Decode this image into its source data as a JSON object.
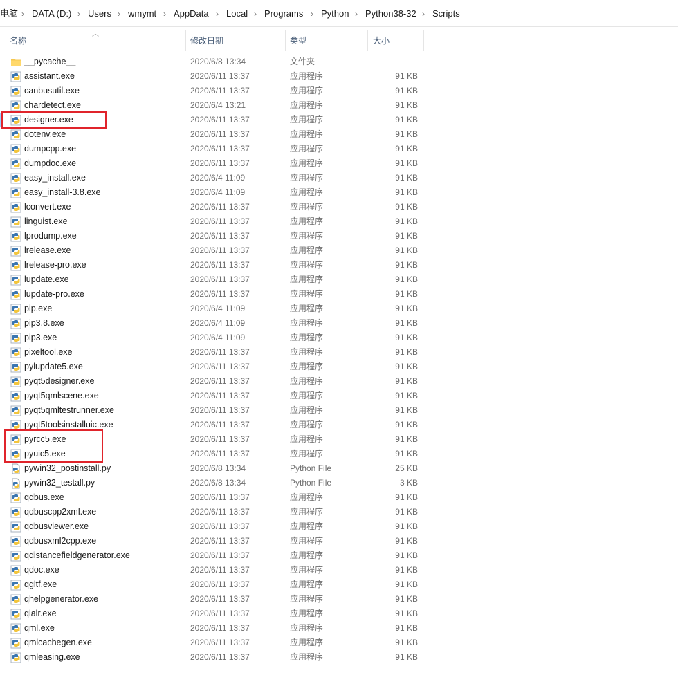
{
  "breadcrumb": [
    "电脑",
    "DATA (D:)",
    "Users",
    "wmymt",
    "AppData",
    "Local",
    "Programs",
    "Python",
    "Python38-32",
    "Scripts"
  ],
  "columns": {
    "name": "名称",
    "date": "修改日期",
    "type": "类型",
    "size": "大小"
  },
  "files": [
    {
      "name": "__pycache__",
      "date": "2020/6/8 13:34",
      "type": "文件夹",
      "size": "",
      "icon": "folder-icon"
    },
    {
      "name": "assistant.exe",
      "date": "2020/6/11 13:37",
      "type": "应用程序",
      "size": "91 KB",
      "icon": "python-exe-icon"
    },
    {
      "name": "canbusutil.exe",
      "date": "2020/6/11 13:37",
      "type": "应用程序",
      "size": "91 KB",
      "icon": "python-exe-icon"
    },
    {
      "name": "chardetect.exe",
      "date": "2020/6/4 13:21",
      "type": "应用程序",
      "size": "91 KB",
      "icon": "python-exe-icon"
    },
    {
      "name": "designer.exe",
      "date": "2020/6/11 13:37",
      "type": "应用程序",
      "size": "91 KB",
      "icon": "python-exe-icon"
    },
    {
      "name": "dotenv.exe",
      "date": "2020/6/11 13:37",
      "type": "应用程序",
      "size": "91 KB",
      "icon": "python-exe-icon"
    },
    {
      "name": "dumpcpp.exe",
      "date": "2020/6/11 13:37",
      "type": "应用程序",
      "size": "91 KB",
      "icon": "python-exe-icon"
    },
    {
      "name": "dumpdoc.exe",
      "date": "2020/6/11 13:37",
      "type": "应用程序",
      "size": "91 KB",
      "icon": "python-exe-icon"
    },
    {
      "name": "easy_install.exe",
      "date": "2020/6/4 11:09",
      "type": "应用程序",
      "size": "91 KB",
      "icon": "python-exe-icon"
    },
    {
      "name": "easy_install-3.8.exe",
      "date": "2020/6/4 11:09",
      "type": "应用程序",
      "size": "91 KB",
      "icon": "python-exe-icon"
    },
    {
      "name": "lconvert.exe",
      "date": "2020/6/11 13:37",
      "type": "应用程序",
      "size": "91 KB",
      "icon": "python-exe-icon"
    },
    {
      "name": "linguist.exe",
      "date": "2020/6/11 13:37",
      "type": "应用程序",
      "size": "91 KB",
      "icon": "python-exe-icon"
    },
    {
      "name": "lprodump.exe",
      "date": "2020/6/11 13:37",
      "type": "应用程序",
      "size": "91 KB",
      "icon": "python-exe-icon"
    },
    {
      "name": "lrelease.exe",
      "date": "2020/6/11 13:37",
      "type": "应用程序",
      "size": "91 KB",
      "icon": "python-exe-icon"
    },
    {
      "name": "lrelease-pro.exe",
      "date": "2020/6/11 13:37",
      "type": "应用程序",
      "size": "91 KB",
      "icon": "python-exe-icon"
    },
    {
      "name": "lupdate.exe",
      "date": "2020/6/11 13:37",
      "type": "应用程序",
      "size": "91 KB",
      "icon": "python-exe-icon"
    },
    {
      "name": "lupdate-pro.exe",
      "date": "2020/6/11 13:37",
      "type": "应用程序",
      "size": "91 KB",
      "icon": "python-exe-icon"
    },
    {
      "name": "pip.exe",
      "date": "2020/6/4 11:09",
      "type": "应用程序",
      "size": "91 KB",
      "icon": "python-exe-icon"
    },
    {
      "name": "pip3.8.exe",
      "date": "2020/6/4 11:09",
      "type": "应用程序",
      "size": "91 KB",
      "icon": "python-exe-icon"
    },
    {
      "name": "pip3.exe",
      "date": "2020/6/4 11:09",
      "type": "应用程序",
      "size": "91 KB",
      "icon": "python-exe-icon"
    },
    {
      "name": "pixeltool.exe",
      "date": "2020/6/11 13:37",
      "type": "应用程序",
      "size": "91 KB",
      "icon": "python-exe-icon"
    },
    {
      "name": "pylupdate5.exe",
      "date": "2020/6/11 13:37",
      "type": "应用程序",
      "size": "91 KB",
      "icon": "python-exe-icon"
    },
    {
      "name": "pyqt5designer.exe",
      "date": "2020/6/11 13:37",
      "type": "应用程序",
      "size": "91 KB",
      "icon": "python-exe-icon"
    },
    {
      "name": "pyqt5qmlscene.exe",
      "date": "2020/6/11 13:37",
      "type": "应用程序",
      "size": "91 KB",
      "icon": "python-exe-icon"
    },
    {
      "name": "pyqt5qmltestrunner.exe",
      "date": "2020/6/11 13:37",
      "type": "应用程序",
      "size": "91 KB",
      "icon": "python-exe-icon"
    },
    {
      "name": "pyqt5toolsinstalluic.exe",
      "date": "2020/6/11 13:37",
      "type": "应用程序",
      "size": "91 KB",
      "icon": "python-exe-icon"
    },
    {
      "name": "pyrcc5.exe",
      "date": "2020/6/11 13:37",
      "type": "应用程序",
      "size": "91 KB",
      "icon": "python-exe-icon"
    },
    {
      "name": "pyuic5.exe",
      "date": "2020/6/11 13:37",
      "type": "应用程序",
      "size": "91 KB",
      "icon": "python-exe-icon"
    },
    {
      "name": "pywin32_postinstall.py",
      "date": "2020/6/8 13:34",
      "type": "Python File",
      "size": "25 KB",
      "icon": "python-file-icon"
    },
    {
      "name": "pywin32_testall.py",
      "date": "2020/6/8 13:34",
      "type": "Python File",
      "size": "3 KB",
      "icon": "python-file-icon"
    },
    {
      "name": "qdbus.exe",
      "date": "2020/6/11 13:37",
      "type": "应用程序",
      "size": "91 KB",
      "icon": "python-exe-icon"
    },
    {
      "name": "qdbuscpp2xml.exe",
      "date": "2020/6/11 13:37",
      "type": "应用程序",
      "size": "91 KB",
      "icon": "python-exe-icon"
    },
    {
      "name": "qdbusviewer.exe",
      "date": "2020/6/11 13:37",
      "type": "应用程序",
      "size": "91 KB",
      "icon": "python-exe-icon"
    },
    {
      "name": "qdbusxml2cpp.exe",
      "date": "2020/6/11 13:37",
      "type": "应用程序",
      "size": "91 KB",
      "icon": "python-exe-icon"
    },
    {
      "name": "qdistancefieldgenerator.exe",
      "date": "2020/6/11 13:37",
      "type": "应用程序",
      "size": "91 KB",
      "icon": "python-exe-icon"
    },
    {
      "name": "qdoc.exe",
      "date": "2020/6/11 13:37",
      "type": "应用程序",
      "size": "91 KB",
      "icon": "python-exe-icon"
    },
    {
      "name": "qgltf.exe",
      "date": "2020/6/11 13:37",
      "type": "应用程序",
      "size": "91 KB",
      "icon": "python-exe-icon"
    },
    {
      "name": "qhelpgenerator.exe",
      "date": "2020/6/11 13:37",
      "type": "应用程序",
      "size": "91 KB",
      "icon": "python-exe-icon"
    },
    {
      "name": "qlalr.exe",
      "date": "2020/6/11 13:37",
      "type": "应用程序",
      "size": "91 KB",
      "icon": "python-exe-icon"
    },
    {
      "name": "qml.exe",
      "date": "2020/6/11 13:37",
      "type": "应用程序",
      "size": "91 KB",
      "icon": "python-exe-icon"
    },
    {
      "name": "qmlcachegen.exe",
      "date": "2020/6/11 13:37",
      "type": "应用程序",
      "size": "91 KB",
      "icon": "python-exe-icon"
    },
    {
      "name": "qmleasing.exe",
      "date": "2020/6/11 13:37",
      "type": "应用程序",
      "size": "91 KB",
      "icon": "python-exe-icon"
    }
  ],
  "colors": {
    "highlight": "#e0242b",
    "selection_border": "#99d1ff",
    "header_text": "#4c607a"
  }
}
